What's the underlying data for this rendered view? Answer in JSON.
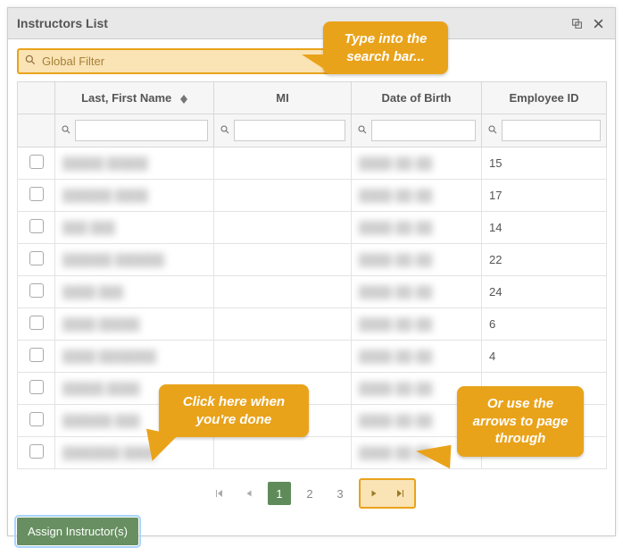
{
  "window": {
    "title": "Instructors List"
  },
  "search": {
    "placeholder": "Global Filter"
  },
  "columns": {
    "name": "Last, First Name",
    "mi": "MI",
    "dob": "Date of Birth",
    "empid": "Employee ID"
  },
  "rows": [
    {
      "empid": "15"
    },
    {
      "empid": "17"
    },
    {
      "empid": "14"
    },
    {
      "empid": "22"
    },
    {
      "empid": "24"
    },
    {
      "empid": "6"
    },
    {
      "empid": "4"
    },
    {
      "empid": ""
    },
    {
      "empid": ""
    },
    {
      "empid": ""
    }
  ],
  "pager": {
    "pages": [
      "1",
      "2",
      "3"
    ],
    "active": "1"
  },
  "actions": {
    "assign": "Assign Instructor(s)"
  },
  "callouts": {
    "search": "Type into the search bar...",
    "done": "Click here when you're done",
    "page": "Or use the arrows to page through"
  }
}
